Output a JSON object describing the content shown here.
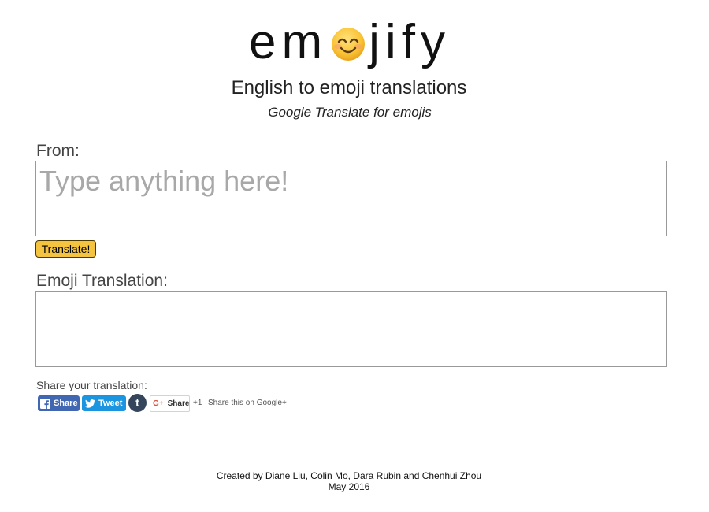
{
  "logo": {
    "prefix": "em",
    "suffix": "jify",
    "emoji_icon": "smiling-face-icon"
  },
  "header": {
    "tagline": "English to emoji translations",
    "subtagline": "Google Translate for emojis"
  },
  "from": {
    "label": "From:",
    "placeholder": "Type anything here!",
    "value": ""
  },
  "translate_button": {
    "label": "Translate!",
    "color": "#f4c33f"
  },
  "output": {
    "label": "Emoji Translation:",
    "value": ""
  },
  "share": {
    "label": "Share your translation:",
    "facebook_label": "Share",
    "facebook_icon": "facebook-icon",
    "twitter_label": "Tweet",
    "twitter_icon": "twitter-bird-icon",
    "tumblr_glyph": "t",
    "tumblr_icon": "tumblr-icon",
    "gplus_glyph": "G+",
    "gplus_label": "Share",
    "plus_one": "+1",
    "gplus_text": "Share this on Google+"
  },
  "footer": {
    "credits": "Created by Diane Liu, Colin Mo, Dara Rubin and Chenhui Zhou",
    "date": "May 2016"
  }
}
